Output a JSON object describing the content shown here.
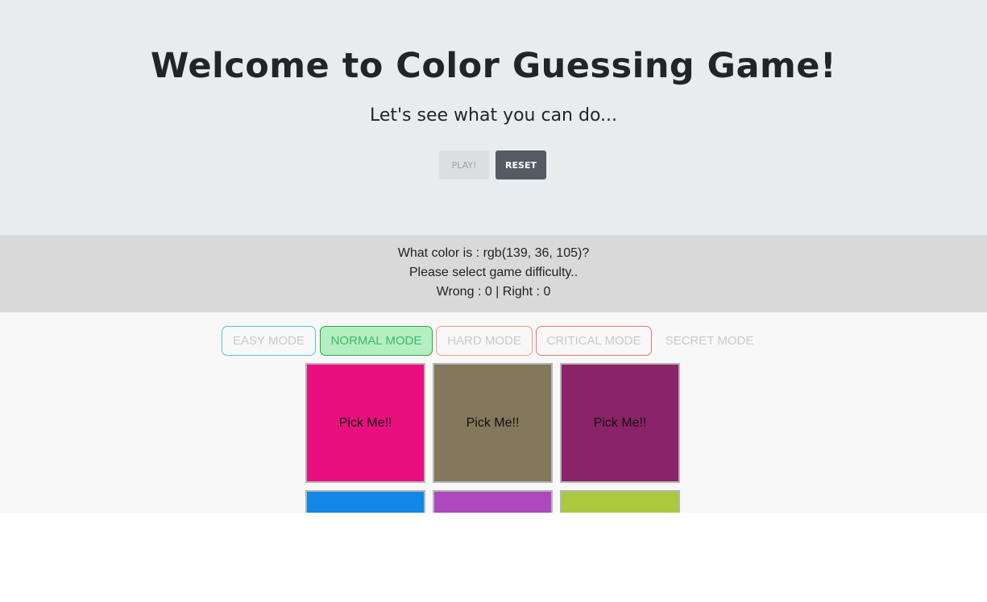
{
  "header": {
    "title": "Welcome to Color Guessing Game!",
    "subtitle": "Let's see what you can do...",
    "play_label": "PLAY!",
    "reset_label": "RESET"
  },
  "status": {
    "question": "What color is : rgb(139, 36, 105)?",
    "instruction": "Please select game difficulty..",
    "score": "Wrong : 0 | Right : 0"
  },
  "modes": [
    {
      "label": "EASY MODE"
    },
    {
      "label": "NORMAL MODE"
    },
    {
      "label": "HARD MODE"
    },
    {
      "label": "CRITICAL MODE"
    },
    {
      "label": "SECRET MODE"
    }
  ],
  "selected_mode": "NORMAL MODE",
  "tiles": [
    {
      "label": "Pick Me!!",
      "color": "#e8107f"
    },
    {
      "label": "Pick Me!!",
      "color": "#83775c"
    },
    {
      "label": "Pick Me!!",
      "color": "#8a2368"
    },
    {
      "label": "",
      "color": "#1287e6"
    },
    {
      "label": "",
      "color": "#ad49bd"
    },
    {
      "label": "",
      "color": "#abc93d"
    }
  ]
}
